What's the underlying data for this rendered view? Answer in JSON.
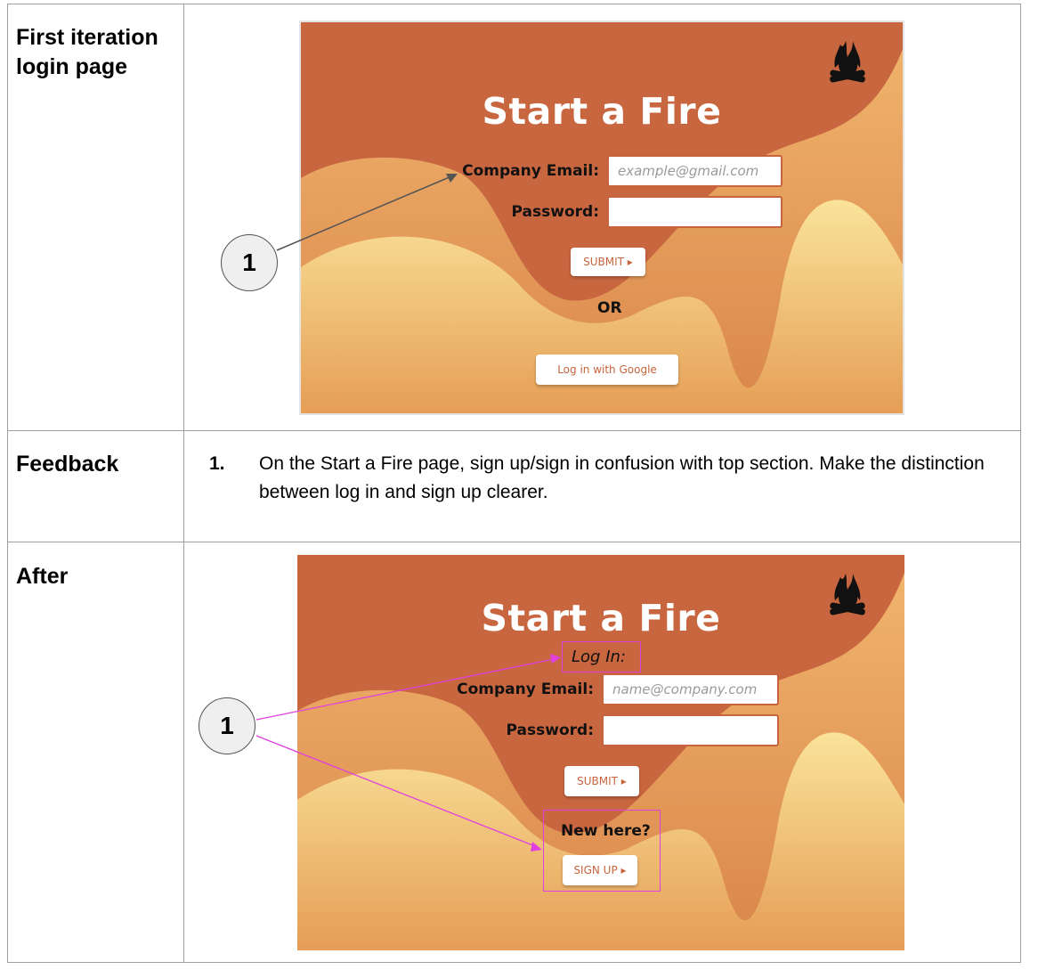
{
  "rows": {
    "first": {
      "label": "First iteration login page"
    },
    "feedback": {
      "label": "Feedback"
    },
    "after": {
      "label": "After"
    }
  },
  "feedback_items": [
    {
      "number": "1.",
      "text": "On the Start a Fire page, sign up/sign in confusion with top section. Make the distinction between log in and sign up clearer."
    }
  ],
  "mockup_before": {
    "title": "Start a Fire",
    "email_label": "Company Email:",
    "email_placeholder": "example@gmail.com",
    "password_label": "Password:",
    "submit_label": "SUBMIT ▸",
    "or_text": "OR",
    "google_button": "Log in with Google",
    "callout": "1"
  },
  "mockup_after": {
    "title": "Start a Fire",
    "login_heading": "Log In:",
    "email_label": "Company Email:",
    "email_placeholder": "name@company.com",
    "password_label": "Password:",
    "submit_label": "SUBMIT ▸",
    "new_here": "New here?",
    "signup_label": "SIGN UP ▸",
    "callout": "1"
  },
  "colors": {
    "rust": "#c8663f",
    "orange": "#e9a05c",
    "cream": "#f8df93",
    "callout_arrow_before": "#555555",
    "callout_arrow_after": "#e040e0"
  },
  "icons": [
    "campfire-icon"
  ]
}
